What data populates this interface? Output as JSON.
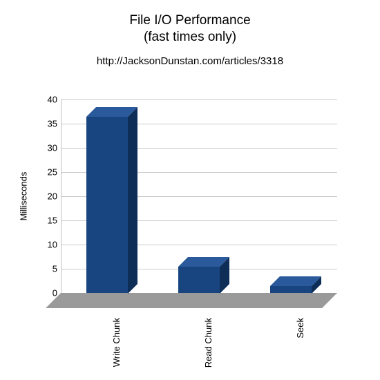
{
  "title_line1": "File I/O Performance",
  "title_line2": "(fast times only)",
  "subtitle": "http://JacksonDunstan.com/articles/3318",
  "chart_data": {
    "type": "bar",
    "categories": [
      "Write Chunk",
      "Read Chunk",
      "Seek"
    ],
    "values": [
      36.5,
      5.5,
      1.5
    ],
    "title": "File I/O Performance (fast times only)",
    "xlabel": "",
    "ylabel": "Milliseconds",
    "ylim": [
      0,
      40
    ],
    "yticks": [
      0,
      5,
      10,
      15,
      20,
      25,
      30,
      35,
      40
    ],
    "bar_color": "#18457f"
  }
}
